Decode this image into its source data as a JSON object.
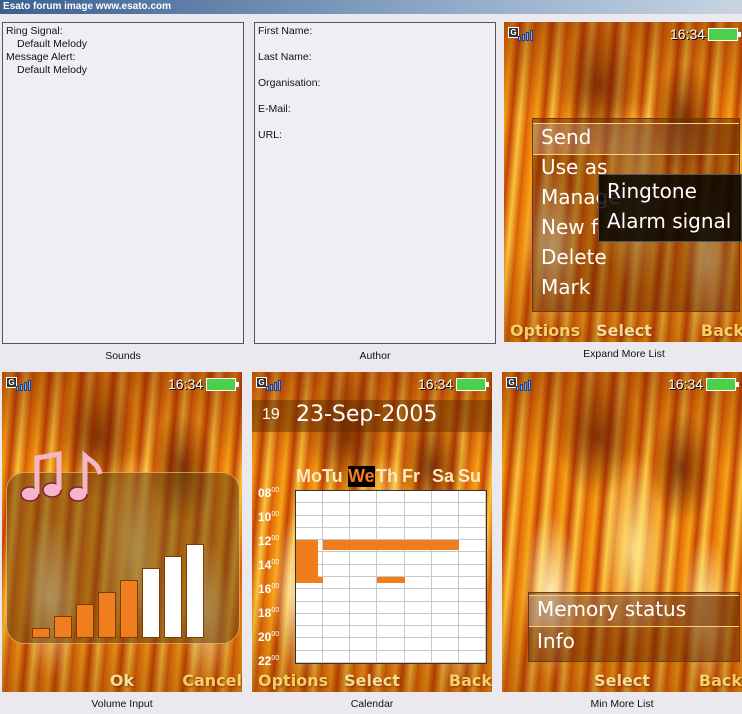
{
  "window": {
    "title": "Esato forum image www.esato.com"
  },
  "sounds_panel": {
    "lines": [
      "Ring Signal:",
      "Default Melody",
      "Message Alert:",
      "Default Melody"
    ],
    "caption": "Sounds"
  },
  "author_panel": {
    "lines": [
      "First Name:",
      "Last Name:",
      "Organisation:",
      "E-Mail:",
      "URL:"
    ],
    "caption": "Author"
  },
  "status": {
    "time": "16:34",
    "network": "G"
  },
  "expand_more_list": {
    "caption": "Expand More List",
    "menu": [
      "Send",
      "Use as",
      "Manage",
      "New f",
      "Delete",
      "Mark"
    ],
    "submenu": [
      "Ringtone",
      "Alarm signal"
    ],
    "softkeys": {
      "left": "Options",
      "middle": "Select",
      "right": "Back"
    }
  },
  "volume_input": {
    "caption": "Volume Input",
    "level": 5,
    "max_level": 8,
    "softkeys": {
      "middle": "Ok",
      "right": "Cancel"
    },
    "colors": {
      "active": "#f07d1e",
      "inactive": "#ffffff"
    }
  },
  "calendar": {
    "caption": "Calendar",
    "week": "19",
    "date": "23-Sep-2005",
    "days": [
      "Mo",
      "Tu",
      "We",
      "Th",
      "Fr",
      "Sa",
      "Su"
    ],
    "selected_day": "We",
    "hours": [
      "08",
      "10",
      "12",
      "14",
      "16",
      "18",
      "20",
      "22"
    ],
    "minute_suffix": "00",
    "softkeys": {
      "left": "Options",
      "middle": "Select",
      "right": "Back"
    },
    "event_color": "#ef7d1b"
  },
  "min_more_list": {
    "caption": "Min More List",
    "menu": [
      "Memory status",
      "Info"
    ],
    "softkeys": {
      "middle": "Select",
      "right": "Back"
    }
  }
}
